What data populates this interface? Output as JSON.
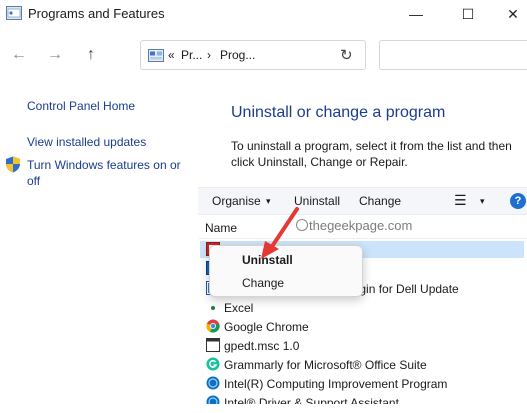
{
  "window": {
    "title": "Programs and Features",
    "minimize_glyph": "—",
    "maximize_glyph": "☐",
    "close_glyph": "✕"
  },
  "nav": {
    "back_glyph": "←",
    "forward_glyph": "→",
    "dropdown_glyph": "⌄",
    "up_glyph": "↑",
    "address_chevrons": "«",
    "address_segment_1": "Pr...",
    "address_sep": "›",
    "address_segment_2": "Prog...",
    "address_dropdown_glyph": "⌄",
    "refresh_glyph": "↻"
  },
  "left_pane": {
    "home": "Control Panel Home",
    "view_updates": "View installed updates",
    "windows_features": "Turn Windows features on or off"
  },
  "main": {
    "title": "Uninstall or change a program",
    "description": "To uninstall a program, select it from the list and then click Uninstall, Change or Repair."
  },
  "toolbar": {
    "organise": "Organise",
    "dd_glyph": "▾",
    "uninstall": "Uninstall",
    "change": "Change",
    "view_glyph": "☰",
    "help_glyph": "?"
  },
  "list": {
    "column_name": "Name",
    "rows": [
      {
        "label": "",
        "icon": "app-icon"
      },
      {
        "label": "",
        "icon": "app-icon"
      },
      {
        "label": "very Plugin for Dell Update",
        "icon": "dell-icon"
      },
      {
        "label": "Excel",
        "icon": "dot-icon"
      },
      {
        "label": "Google Chrome",
        "icon": "chrome-icon"
      },
      {
        "label": "gpedt.msc 1.0",
        "icon": "window-icon"
      },
      {
        "label": "Grammarly for Microsoft® Office Suite",
        "icon": "grammarly-icon"
      },
      {
        "label": "Intel(R) Computing Improvement Program",
        "icon": "intel-icon"
      },
      {
        "label": "Intel® Driver & Support Assistant",
        "icon": "intel-icon"
      }
    ]
  },
  "watermark": {
    "text": "thegeekpage.com"
  },
  "context_menu": {
    "uninstall": "Uninstall",
    "change": "Change"
  },
  "colors": {
    "link": "#1a3d8f",
    "selection": "#cce4fb",
    "annotation_arrow": "#e53935"
  }
}
